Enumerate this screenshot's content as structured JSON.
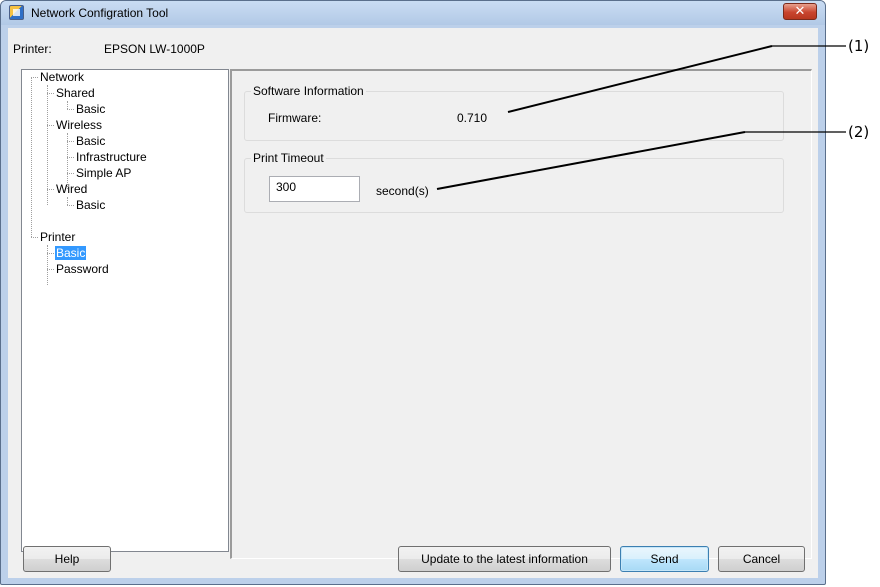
{
  "window": {
    "title": "Network Configration Tool",
    "close_glyph": "✕"
  },
  "printer": {
    "label": "Printer:",
    "value": "EPSON LW-1000P"
  },
  "tree": {
    "network": "Network",
    "shared": "Shared",
    "shared_basic": "Basic",
    "wireless": "Wireless",
    "wireless_basic": "Basic",
    "wireless_infrastructure": "Infrastructure",
    "wireless_simple_ap": "Simple AP",
    "wired": "Wired",
    "wired_basic": "Basic",
    "printer": "Printer",
    "printer_basic": "Basic",
    "printer_password": "Password"
  },
  "software_info": {
    "title": "Software Information",
    "firmware_label": "Firmware:",
    "firmware_value": "0.710"
  },
  "print_timeout": {
    "title": "Print Timeout",
    "value": "300",
    "unit": "second(s)"
  },
  "buttons": {
    "help": "Help",
    "update": "Update to the latest information",
    "send": "Send",
    "cancel": "Cancel"
  },
  "callouts": {
    "one": "(1)",
    "two": "(2)"
  }
}
